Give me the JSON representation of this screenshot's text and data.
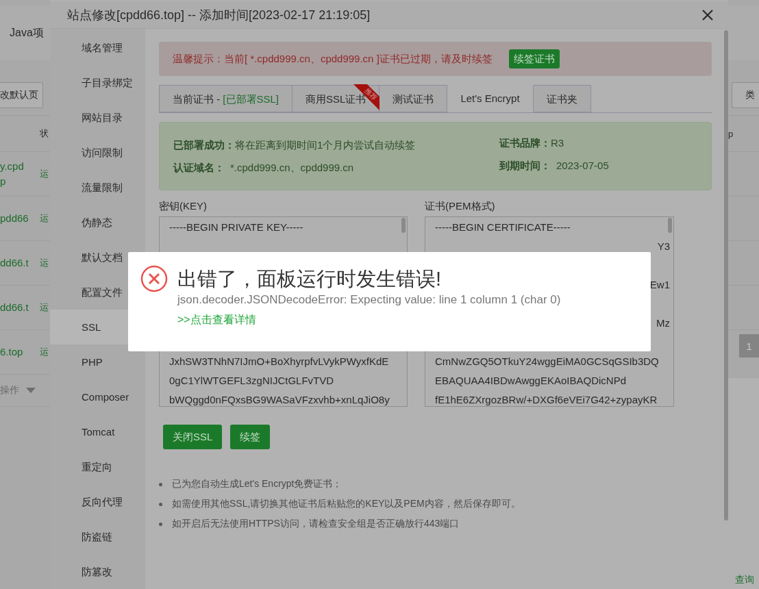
{
  "background_page": {
    "tab": "Java项",
    "default_page_button": "改默认页",
    "column_header": "状",
    "rows": [
      {
        "name_lines": [
          "y.cpd",
          "p"
        ],
        "status": "运"
      },
      {
        "name_lines": [
          "pdd66"
        ],
        "status": "运"
      },
      {
        "name_lines": [
          "dd66.t"
        ],
        "status": "运"
      },
      {
        "name_lines": [
          "dd66.t"
        ],
        "status": "运"
      },
      {
        "name_lines": [
          "6.top"
        ],
        "status": "运"
      }
    ],
    "batch_select": "操作",
    "category_button": "类",
    "right_header": "p",
    "page_number": "1",
    "query_link": "查询"
  },
  "modal": {
    "title": "站点修改[cpdd66.top] -- 添加时间[2023-02-17 21:19:05]",
    "sidebar": {
      "items": [
        {
          "label": "域名管理",
          "selected": false
        },
        {
          "label": "子目录绑定",
          "selected": false
        },
        {
          "label": "网站目录",
          "selected": false
        },
        {
          "label": "访问限制",
          "selected": false
        },
        {
          "label": "流量限制",
          "selected": false
        },
        {
          "label": "伪静态",
          "selected": false
        },
        {
          "label": "默认文档",
          "selected": false
        },
        {
          "label": "配置文件",
          "selected": false
        },
        {
          "label": "SSL",
          "selected": true
        },
        {
          "label": "PHP",
          "selected": false
        },
        {
          "label": "Composer",
          "selected": false
        },
        {
          "label": "Tomcat",
          "selected": false
        },
        {
          "label": "重定向",
          "selected": false
        },
        {
          "label": "反向代理",
          "selected": false
        },
        {
          "label": "防盗链",
          "selected": false
        },
        {
          "label": "防篡改",
          "selected": false
        }
      ]
    },
    "alert": {
      "text": "温馨提示：当前[ *.cpdd999.cn、cpdd999.cn ]证书已过期，请及时续签",
      "button": "续签证书"
    },
    "tabs": [
      {
        "label": "当前证书 - ",
        "status": "[已部署SSL]",
        "selected": false
      },
      {
        "label": "商用SSL证书",
        "badge": "推荐",
        "selected": false
      },
      {
        "label": "测试证书",
        "selected": false
      },
      {
        "label": "Let's Encrypt",
        "selected": true
      },
      {
        "label": "证书夹",
        "selected": false
      }
    ],
    "info": {
      "deployed_label": "已部署成功：",
      "deployed_text": "将在距离到期时间1个月内尝试自动续签",
      "domain_label": "认证域名：",
      "domain": "*.cpdd999.cn、cpdd999.cn",
      "brand_label": "证书品牌：",
      "brand": "R3",
      "expiry_label": "到期时间：",
      "expiry": "2023-07-05"
    },
    "key": {
      "label": "密钥(KEY)",
      "first_line": "-----BEGIN PRIVATE KEY-----",
      "lines": [
        "JxhSW3TNhN7IJmO+BoXhyrpfvLVykPWyxfKdE",
        "0gC1YlWTGEFL3zgNIJCtGLFvTVD",
        "bWQggd0nFQxsBG9WASaVFzxvhb+xnLqJiO8y"
      ]
    },
    "cert": {
      "label": "证书(PEM格式)",
      "first_line": "-----BEGIN CERTIFICATE-----",
      "line_tails": [
        "Y3",
        "Ew1",
        "Mz"
      ],
      "lines": [
        "CmNwZGQ5OTkuY24wggEiMA0GCSqGSIb3DQ",
        "EBAQUAA4IBDwAwggEKAoIBAQDicNPd",
        "fE1hE6ZXrgozBRw/+DXGf6eVEi7G42+zypayKR"
      ]
    },
    "buttons": [
      "关闭SSL",
      "续签"
    ],
    "notes": [
      "已为您自动生成Let's Encrypt免费证书；",
      "如需使用其他SSL,请切换其他证书后粘贴您的KEY以及PEM内容，然后保存即可。",
      "如开启后无法使用HTTPS访问，请检查安全组是否正确放行443端口"
    ]
  },
  "error_toast": {
    "title": "出错了，面板运行时发生错误!",
    "message": "json.decoder.JSONDecodeError: Expecting value: line 1 column 1 (char 0)",
    "link": ">>点击查看详情"
  }
}
